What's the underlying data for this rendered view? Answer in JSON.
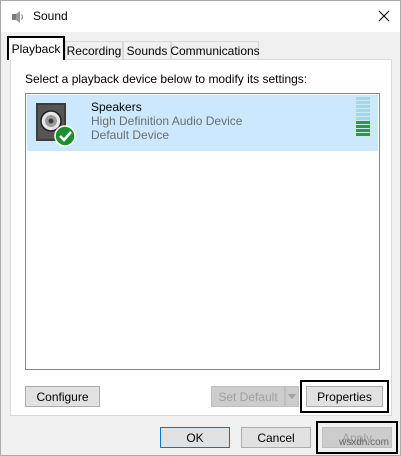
{
  "window": {
    "title": "Sound"
  },
  "tabs": [
    {
      "label": "Playback",
      "active": true
    },
    {
      "label": "Recording",
      "active": false
    },
    {
      "label": "Sounds",
      "active": false
    },
    {
      "label": "Communications",
      "active": false
    }
  ],
  "panel": {
    "instruction": "Select a playback device below to modify its settings:",
    "devices": [
      {
        "name": "Speakers",
        "description": "High Definition Audio Device",
        "status": "Default Device",
        "icon": "speaker-icon",
        "badge": "default-check-icon",
        "level_segments_lit": 4,
        "level_segments_total": 10
      }
    ],
    "buttons": {
      "configure": "Configure",
      "set_default": "Set Default",
      "properties": "Properties"
    }
  },
  "footer": {
    "ok": "OK",
    "cancel": "Cancel",
    "apply": "Apply"
  },
  "watermark": "wsxdn.com",
  "colors": {
    "selection": "#cce8ff",
    "accent": "#0078d7",
    "check": "#2b9a3a",
    "meter_lit": "#2e9b3a",
    "meter_dim": "#a7d8e0"
  }
}
